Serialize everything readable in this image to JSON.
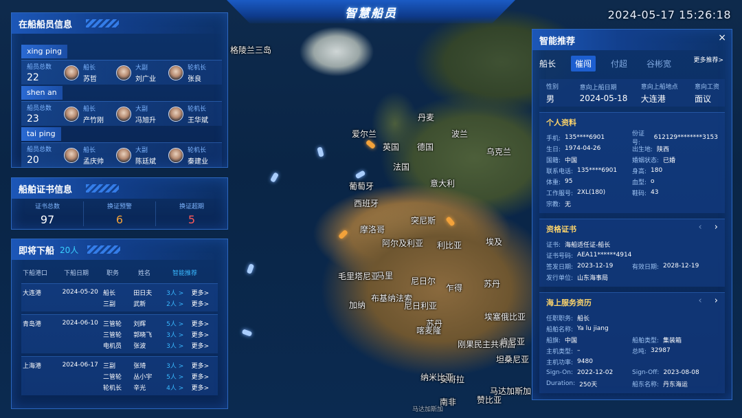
{
  "header": {
    "title": "智慧船员",
    "datetime": "2024-05-17   15:26:18"
  },
  "map": {
    "labels": [
      "格陵兰三岛",
      "丹麦",
      "爱尔兰",
      "波兰",
      "德国",
      "乌克兰",
      "英国",
      "法国",
      "意大利",
      "葡萄牙",
      "西班牙",
      "摩洛哥",
      "阿尔及利亚",
      "利比亚",
      "埃及",
      "突尼斯",
      "马里",
      "尼日尔",
      "乍得",
      "苏丹",
      "毛里塔尼亚",
      "布基纳法索",
      "尼日利亚",
      "埃塞俄比亚",
      "刚果民主共和国",
      "安哥拉",
      "坦桑尼亚",
      "赞比亚",
      "苏丹",
      "南非",
      "马达加斯加",
      "肯尼亚",
      "加纳",
      "喀麦隆",
      "纳米比亚"
    ],
    "attribution": "马达加斯加"
  },
  "crew_panel": {
    "title": "在船船员信息",
    "total_label": "船员总数",
    "ships": [
      {
        "name": "xing ping",
        "total": "22",
        "crew": [
          {
            "role": "船长",
            "name": "苏哲"
          },
          {
            "role": "大副",
            "name": "刘广业"
          },
          {
            "role": "轮机长",
            "name": "张良"
          }
        ]
      },
      {
        "name": "shen an",
        "total": "23",
        "crew": [
          {
            "role": "船长",
            "name": "产竹刚"
          },
          {
            "role": "大副",
            "name": "冯旭升"
          },
          {
            "role": "轮机长",
            "name": "王华斌"
          }
        ]
      },
      {
        "name": "tai ping",
        "total": "20",
        "crew": [
          {
            "role": "船长",
            "name": "孟庆帅"
          },
          {
            "role": "大副",
            "name": "陈廷斌"
          },
          {
            "role": "轮机长",
            "name": "秦建业"
          }
        ]
      }
    ]
  },
  "cert_panel": {
    "title": "船舶证书信息",
    "stats": [
      {
        "label": "证书总数",
        "value": "97",
        "color": "#ffffff"
      },
      {
        "label": "换证预警",
        "value": "6",
        "color": "#f3a23a"
      },
      {
        "label": "换证超期",
        "value": "5",
        "color": "#ff5a5a"
      }
    ]
  },
  "disembark_panel": {
    "title": "即将下船",
    "count": "20人",
    "headers": [
      "下船港口",
      "下船日期",
      "职务",
      "姓名",
      "智能推荐"
    ],
    "groups": [
      {
        "port": "大连港",
        "date": "2024-05-20",
        "rows": [
          {
            "role": "船长",
            "name": "田日夫",
            "rec": "3人 >",
            "more": "更多>"
          },
          {
            "role": "三副",
            "name": "武新",
            "rec": "2人 >",
            "more": "更多>"
          }
        ]
      },
      {
        "port": "青岛港",
        "date": "2024-06-10",
        "rows": [
          {
            "role": "三管轮",
            "name": "刘辉",
            "rec": "5人 >",
            "more": "更多>"
          },
          {
            "role": "三管轮",
            "name": "郭晓飞",
            "rec": "3人 >",
            "more": "更多>"
          },
          {
            "role": "电机员",
            "name": "张波",
            "rec": "3人 >",
            "more": "更多>"
          }
        ]
      },
      {
        "port": "上海港",
        "date": "2024-06-17",
        "rows": [
          {
            "role": "三副",
            "name": "张琦",
            "rec": "3人 >",
            "more": "更多>"
          },
          {
            "role": "二管轮",
            "name": "丛小宇",
            "rec": "5人 >",
            "more": "更多>"
          },
          {
            "role": "轮机长",
            "name": "辛光",
            "rec": "4人 >",
            "more": "更多>"
          }
        ]
      }
    ]
  },
  "rec_panel": {
    "title": "智能推荐",
    "close": "×",
    "lead": "船长",
    "tabs": [
      "催闯",
      "付超",
      "谷彬宽"
    ],
    "more": "更多推荐>",
    "intent": [
      {
        "label": "性别",
        "value": "男"
      },
      {
        "label": "意向上船日期",
        "value": "2024-05-18"
      },
      {
        "label": "意向上船地点",
        "value": "大连港"
      },
      {
        "label": "意向工资",
        "value": "面议"
      }
    ],
    "profile": {
      "title": "个人资料",
      "fields": [
        {
          "k": "手机:",
          "v": "135****6901"
        },
        {
          "k": "份证号:",
          "v": "612129********3153"
        },
        {
          "k": "生日:",
          "v": "1974-04-26"
        },
        {
          "k": "出生地:",
          "v": "陕西"
        },
        {
          "k": "国籍:",
          "v": "中国"
        },
        {
          "k": "婚姻状态:",
          "v": "已婚"
        },
        {
          "k": "联系电话:",
          "v": "135****6901"
        },
        {
          "k": "身高:",
          "v": "180"
        },
        {
          "k": "体重:",
          "v": "95"
        },
        {
          "k": "血型:",
          "v": "o"
        },
        {
          "k": "工作服号:",
          "v": "2XL(180)"
        },
        {
          "k": "鞋码:",
          "v": "43"
        },
        {
          "k": "宗教:",
          "v": "无"
        }
      ]
    },
    "cert": {
      "title": "资格证书",
      "prev": "‹",
      "next": "›",
      "fields": [
        {
          "k": "证书:",
          "v": "海船适任证-船长",
          "full": true
        },
        {
          "k": "证书号码:",
          "v": "AEA11******4914",
          "full": true
        },
        {
          "k": "签发日期:",
          "v": "2023-12-19"
        },
        {
          "k": "有效日期:",
          "v": "2028-12-19"
        },
        {
          "k": "发行单位:",
          "v": "山东海事局",
          "full": true
        }
      ]
    },
    "service": {
      "title": "海上服务资历",
      "prev": "‹",
      "next": "›",
      "fields": [
        {
          "k": "任职职务:",
          "v": "船长",
          "full": true
        },
        {
          "k": "船舶名称:",
          "v": "Ya lu jiang",
          "full": true
        },
        {
          "k": "船旗:",
          "v": "中国"
        },
        {
          "k": "船舶类型:",
          "v": "集装箱"
        },
        {
          "k": "主机类型:",
          "v": "–"
        },
        {
          "k": "总吨:",
          "v": "32987"
        },
        {
          "k": "主机功率:",
          "v": "9480",
          "full": true
        },
        {
          "k": "Sign-On:",
          "v": "2022-12-02"
        },
        {
          "k": "Sign-Off:",
          "v": "2023-08-08"
        },
        {
          "k": "Duration:",
          "v": "250天"
        },
        {
          "k": "船东名称:",
          "v": "丹东海运"
        }
      ]
    }
  }
}
